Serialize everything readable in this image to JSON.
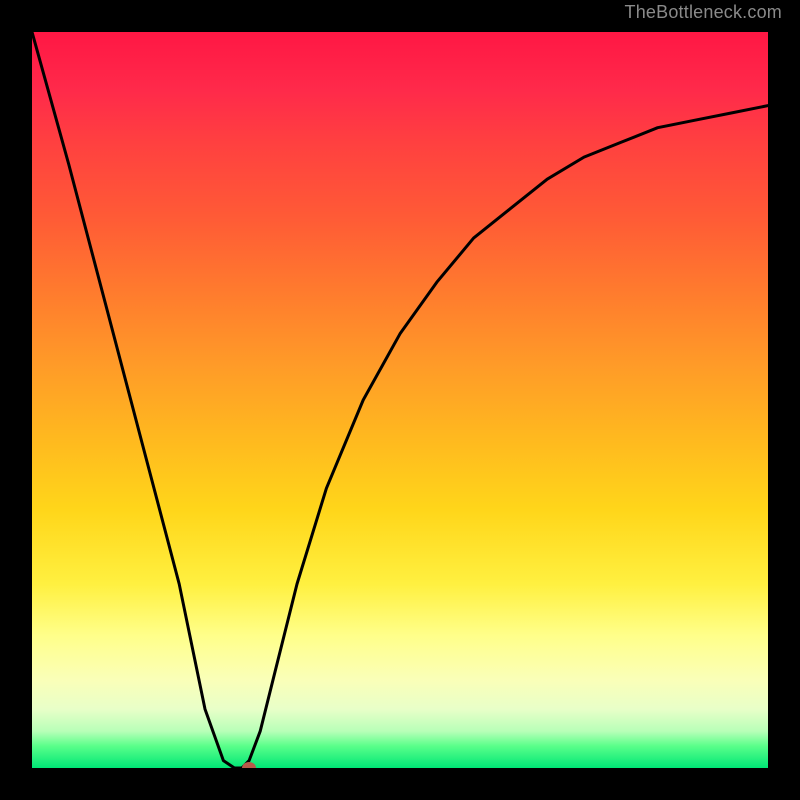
{
  "watermark": "TheBottleneck.com",
  "colors": {
    "top": "#ff1744",
    "mid": "#ffd61a",
    "bottom": "#00e676",
    "curve": "#000000",
    "dot": "#b85a4a",
    "frame": "#000000"
  },
  "chart_data": {
    "type": "line",
    "title": "",
    "xlabel": "",
    "ylabel": "",
    "xlim": [
      0,
      1
    ],
    "ylim": [
      0,
      1
    ],
    "grid": false,
    "legend": false,
    "series": [
      {
        "name": "bottleneck-curve",
        "x": [
          0.0,
          0.05,
          0.1,
          0.15,
          0.2,
          0.235,
          0.26,
          0.275,
          0.285,
          0.295,
          0.31,
          0.33,
          0.36,
          0.4,
          0.45,
          0.5,
          0.55,
          0.6,
          0.65,
          0.7,
          0.75,
          0.8,
          0.85,
          0.9,
          0.95,
          1.0
        ],
        "y": [
          1.0,
          0.82,
          0.63,
          0.44,
          0.25,
          0.08,
          0.01,
          0.0,
          0.0,
          0.01,
          0.05,
          0.13,
          0.25,
          0.38,
          0.5,
          0.59,
          0.66,
          0.72,
          0.76,
          0.8,
          0.83,
          0.85,
          0.87,
          0.88,
          0.89,
          0.9
        ]
      }
    ],
    "marker": {
      "x": 0.295,
      "y": 0.0,
      "color": "#b85a4a"
    },
    "background_gradient": {
      "direction": "top-to-bottom",
      "stops": [
        {
          "pos": 0.0,
          "color": "#ff1744"
        },
        {
          "pos": 0.55,
          "color": "#ffd61a"
        },
        {
          "pos": 0.88,
          "color": "#faffb8"
        },
        {
          "pos": 1.0,
          "color": "#00e676"
        }
      ]
    }
  }
}
